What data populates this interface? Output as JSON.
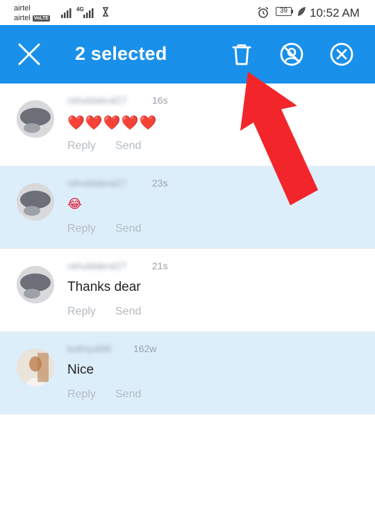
{
  "status_bar": {
    "carrier1": "airtel",
    "carrier2": "airtel",
    "volte": "VoLTE",
    "network_type": "4G",
    "battery": "39",
    "time": "10:52 AM"
  },
  "action_bar": {
    "title": "2 selected",
    "close_icon": "close-icon",
    "delete_icon": "trash-icon",
    "restrict_icon": "restrict-icon",
    "block_icon": "block-icon",
    "background": "#1990ea"
  },
  "comments": [
    {
      "username": "rahuldabral27",
      "time": "16s",
      "text": "❤️❤️❤️❤️❤️",
      "reply": "Reply",
      "send": "Send",
      "selected": false
    },
    {
      "username": "rahuldabral27",
      "time": "23s",
      "text": "😂",
      "reply": "Reply",
      "send": "Send",
      "selected": true
    },
    {
      "username": "rahuldabral27",
      "time": "21s",
      "text": "Thanks dear",
      "reply": "Reply",
      "send": "Send",
      "selected": false
    },
    {
      "username": "kothiyal98",
      "time": "162w",
      "text": "Nice",
      "reply": "Reply",
      "send": "Send",
      "selected": true
    }
  ],
  "colors": {
    "selected_row": "#ddeefb",
    "annotation_arrow": "#f2262a"
  }
}
